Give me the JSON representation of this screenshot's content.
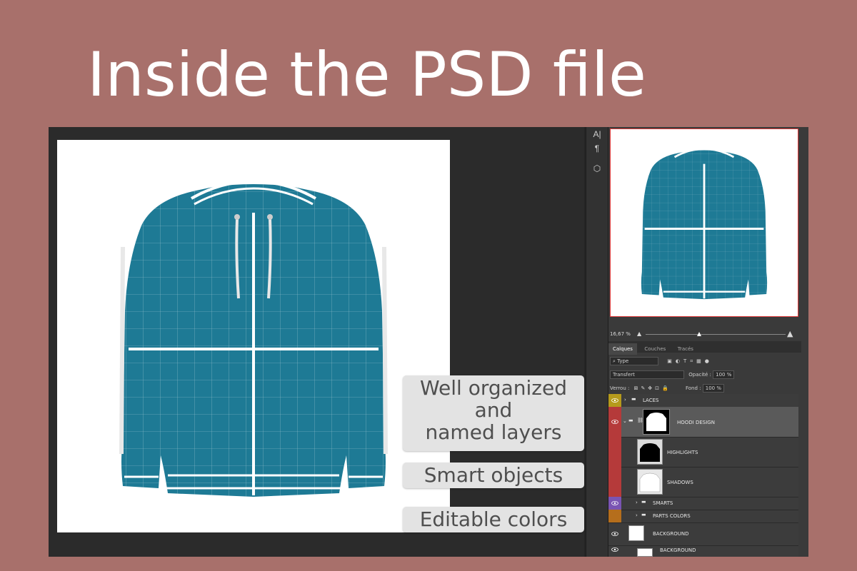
{
  "headline": "Inside the PSD file",
  "navigator": {
    "zoom": "16,67 %"
  },
  "tabs": [
    "Calques",
    "Couches",
    "Tracés"
  ],
  "filter": {
    "kind": "Type"
  },
  "blend": {
    "mode": "Transfert",
    "opacity_label": "Opacité :",
    "opacity_value": "100 %"
  },
  "lock": {
    "label": "Verrou :",
    "fill_label": "Fond :",
    "fill_value": "100 %"
  },
  "layers": [
    {
      "name": "LACES",
      "color": "#b59a1c"
    },
    {
      "name": "HOODI DESIGN",
      "color": "#b53a3a"
    },
    {
      "name": "HIGHLIGHTS",
      "color": "#b53a3a"
    },
    {
      "name": "SHADOWS",
      "color": "#b53a3a"
    },
    {
      "name": "SMARTS",
      "color": "#7a54b3"
    },
    {
      "name": "PARTS COLORS",
      "color": "#b56e1c"
    },
    {
      "name": "BACKGROUND",
      "color": "#3c3c3c"
    },
    {
      "name": "BACKGROUND"
    }
  ],
  "callouts": [
    {
      "lines": [
        "Well organized",
        "and",
        "named layers"
      ]
    },
    {
      "lines": [
        "Smart objects"
      ]
    },
    {
      "lines": [
        "Editable colors"
      ]
    }
  ],
  "colors": {
    "background": "#a8706b",
    "hoodie": "#1e7a95",
    "grid": "#ffffff"
  },
  "icons": [
    "text-tool-icon",
    "paragraph-icon",
    "3d-icon",
    "eye-icon",
    "folder-icon",
    "chain-link-icon",
    "mountain-small-icon",
    "mountain-large-icon"
  ]
}
